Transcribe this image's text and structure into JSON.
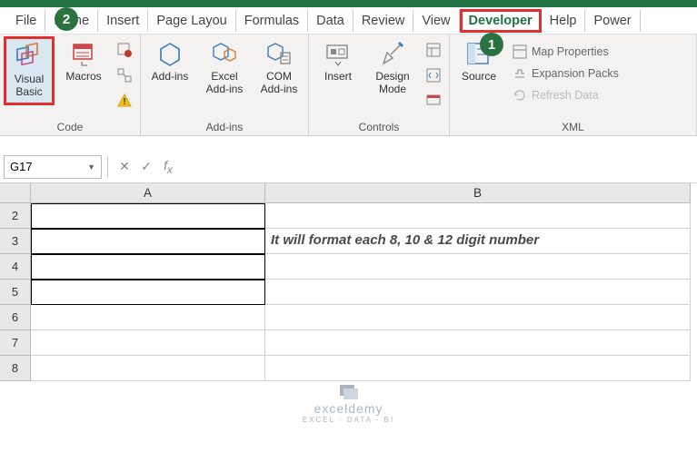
{
  "menubar": {
    "tabs": [
      "File",
      "Home",
      "Insert",
      "Page Layou",
      "Formulas",
      "Data",
      "Review",
      "View",
      "Developer",
      "Help",
      "Power"
    ],
    "active_index": 8
  },
  "ribbon": {
    "code": {
      "visual_basic": "Visual Basic",
      "macros": "Macros",
      "label": "Code"
    },
    "addins": {
      "addins": "Add-ins",
      "excel_addins": "Excel Add-ins",
      "com_addins": "COM Add-ins",
      "label": "Add-ins"
    },
    "controls": {
      "insert": "Insert",
      "design_mode": "Design Mode",
      "label": "Controls"
    },
    "xml": {
      "source": "Source",
      "map_properties": "Map Properties",
      "expansion_packs": "Expansion Packs",
      "refresh_data": "Refresh Data",
      "label": "XML"
    }
  },
  "callouts": {
    "one": "1",
    "two": "2"
  },
  "formula_bar": {
    "cell_ref": "G17",
    "formula": ""
  },
  "columns": {
    "a": "A",
    "b": "B"
  },
  "rows": {
    "r2": "2",
    "r3": "3",
    "r4": "4",
    "r5": "5",
    "r6": "6",
    "r7": "7",
    "r8": "8"
  },
  "cells": {
    "b3": "It will format each 8, 10 & 12 digit number"
  },
  "logo": {
    "name": "exceldemy",
    "tag": "EXCEL · DATA · BI"
  }
}
